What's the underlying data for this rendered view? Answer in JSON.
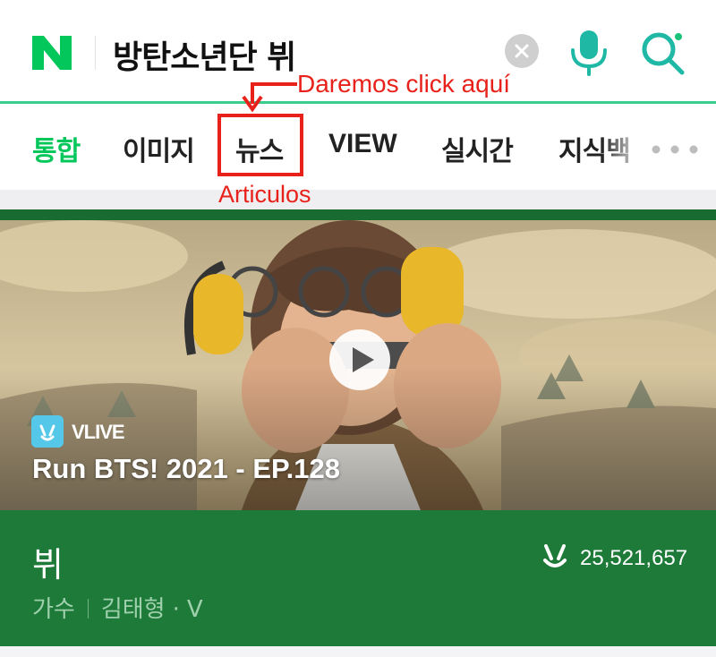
{
  "search": {
    "logo_text": "N",
    "query": "방탄소년단 뷔",
    "icons": [
      "naver-logo-icon",
      "clear-icon",
      "microphone-icon",
      "lens-search-icon"
    ]
  },
  "annotation": {
    "top_text": "Daremos click aquí",
    "bottom_text": "Articulos",
    "color": "#e8221b"
  },
  "tabs": [
    {
      "label": "통합",
      "active": true
    },
    {
      "label": "이미지",
      "active": false
    },
    {
      "label": "뉴스",
      "active": false
    },
    {
      "label": "VIEW",
      "active": false
    },
    {
      "label": "실시간",
      "active": false
    },
    {
      "label": "지식백",
      "active": false
    }
  ],
  "card": {
    "vlive_label": "VLIVE",
    "video_title": "Run BTS! 2021 - EP.128",
    "artist_name": "뷔",
    "artist_role": "가수",
    "artist_realname": "김태형",
    "artist_alias": "V",
    "fan_count": "25,521,657"
  },
  "colors": {
    "naver_green": "#03c75a",
    "card_green": "#1e7a38",
    "mic_teal": "#1fb8a5"
  }
}
